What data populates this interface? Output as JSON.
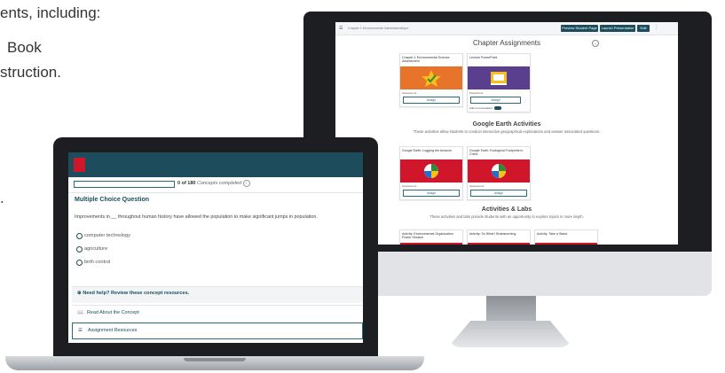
{
  "intro": {
    "line1": "ents, including:",
    "line2": "Book",
    "line3": "struction.",
    "line4": "."
  },
  "desktop": {
    "topbar": {
      "breadcrumb": "Chapter 1 Environmental Interrelationships",
      "preview_btn": "Preview Student Page",
      "launch_btn": "Launch Presentation",
      "edit_btn": "Edit"
    },
    "chapter_assignments": {
      "title": "Chapter Assignments",
      "cards": [
        {
          "title": "Chapter 1 Environmental Science Assessment",
          "meta": "Assessment",
          "button": "Assign",
          "color": "#e8732a"
        },
        {
          "title": "Lecture PowerPoint",
          "meta": "PowerPoint",
          "button": "Assign",
          "toggle_label": "Add to presentation",
          "color": "#5b3f8f"
        }
      ]
    },
    "google_earth": {
      "title": "Google Earth Activities",
      "subtitle": "These activities allow students to conduct interactive geographical explorations and answer associated questions.",
      "cards": [
        {
          "title": "Google Earth: Logging the Amazon",
          "meta": "Assessment",
          "button": "Assign",
          "color": "#d0162b"
        },
        {
          "title": "Google Earth: Ecological Footprints in China",
          "meta": "Assessment",
          "button": "Assign",
          "color": "#d0162b"
        }
      ]
    },
    "activities_labs": {
      "title": "Activities & Labs",
      "subtitle": "These activities and labs provide students with an opportunity to explore topics in more depth.",
      "cards": [
        {
          "title": "Activity: Environmental Organization Poster Session"
        },
        {
          "title": "Activity: So What? Brainstorming"
        },
        {
          "title": "Activity: Take a Stand"
        }
      ]
    }
  },
  "laptop": {
    "logo": "Mc Graw Hill",
    "progress": {
      "count": "0 of 180",
      "label": "Concepts completed"
    },
    "question_title": "Multiple Choice Question",
    "question_text": "Improvements in __ throughout human history have allowed the population to make significant jumps in population.",
    "options": [
      "computer technology",
      "agriculture",
      "birth control"
    ],
    "help_label": "Need help? Review these concept resources.",
    "read_label": "Read About the Concept",
    "resources_label": "Assignment Resources"
  }
}
